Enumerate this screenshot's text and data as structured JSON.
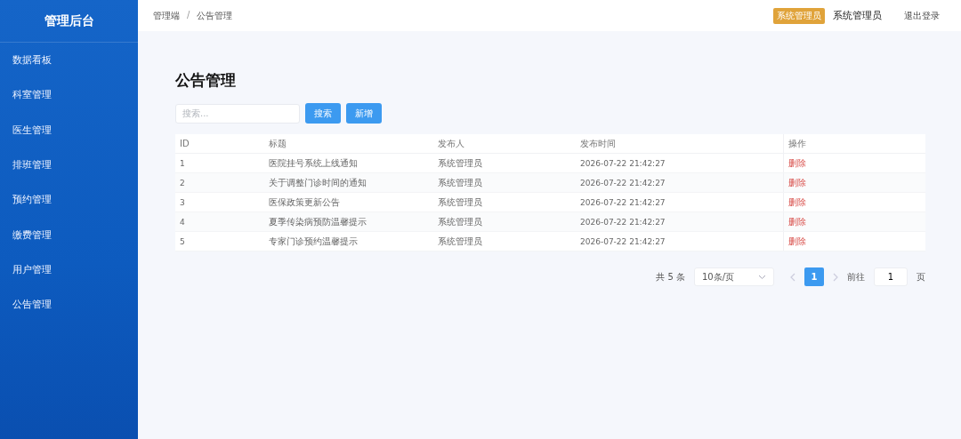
{
  "sidebar": {
    "title": "管理后台",
    "items": [
      {
        "label": "数据看板"
      },
      {
        "label": "科室管理"
      },
      {
        "label": "医生管理"
      },
      {
        "label": "排班管理"
      },
      {
        "label": "预约管理"
      },
      {
        "label": "缴费管理"
      },
      {
        "label": "用户管理"
      },
      {
        "label": "公告管理"
      }
    ]
  },
  "header": {
    "breadcrumb": [
      "管理端",
      "公告管理"
    ],
    "separator": "/",
    "role_badge": "系统管理员",
    "user_name": "系统管理员",
    "logout": "退出登录"
  },
  "page_title": "公告管理",
  "search": {
    "placeholder": "搜索..."
  },
  "buttons": [
    "搜索",
    "新增"
  ],
  "table": {
    "columns": [
      "ID",
      "标题",
      "发布人",
      "发布时间",
      "操作"
    ],
    "rows": [
      {
        "id": "1",
        "title": "医院挂号系统上线通知",
        "publisher": "系统管理员",
        "time": "2026-07-22 21:42:27",
        "action": "删除"
      },
      {
        "id": "2",
        "title": "关于调整门诊时间的通知",
        "publisher": "系统管理员",
        "time": "2026-07-22 21:42:27",
        "action": "删除"
      },
      {
        "id": "3",
        "title": "医保政策更新公告",
        "publisher": "系统管理员",
        "time": "2026-07-22 21:42:27",
        "action": "删除"
      },
      {
        "id": "4",
        "title": "夏季传染病预防温馨提示",
        "publisher": "系统管理员",
        "time": "2026-07-22 21:42:27",
        "action": "删除"
      },
      {
        "id": "5",
        "title": "专家门诊预约温馨提示",
        "publisher": "系统管理员",
        "time": "2026-07-22 21:42:27",
        "action": "删除"
      }
    ]
  },
  "pagination": {
    "total": "共 5 条",
    "page_size": "10条/页",
    "prev_disabled": true,
    "next_disabled": true,
    "pages": [
      {
        "label": "1",
        "selected": true
      }
    ],
    "goto_label": "前往",
    "goto_value": "1",
    "goto_suffix": "页"
  }
}
